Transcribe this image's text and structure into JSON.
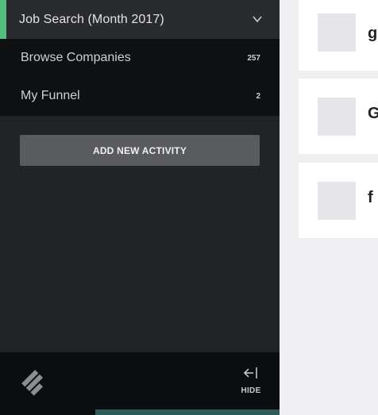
{
  "sidebar": {
    "header": {
      "title": "Job Search (Month 2017)",
      "accent_color": "#4fbf7b",
      "toggle_icon": "chevron-down-icon"
    },
    "nav": [
      {
        "label": "Browse Companies",
        "count": "257"
      },
      {
        "label": "My Funnel",
        "count": "2"
      }
    ],
    "add_button": "ADD NEW ACTIVITY",
    "footer": {
      "logo_icon": "logo-icon",
      "hide_label": "HIDE",
      "hide_icon": "collapse-left-icon"
    }
  },
  "main": {
    "cards": [
      {
        "name": "g"
      },
      {
        "name": "G"
      },
      {
        "name": "f"
      }
    ]
  }
}
